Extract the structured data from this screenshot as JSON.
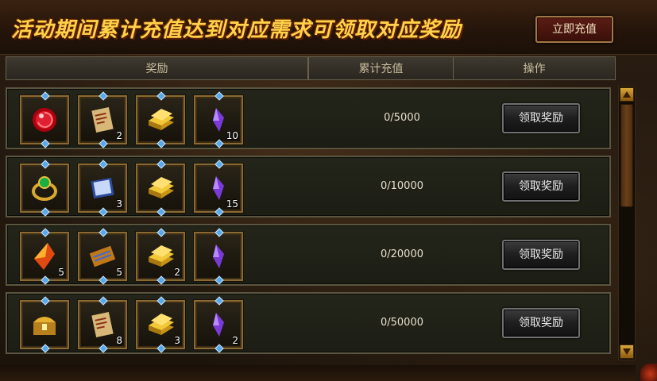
{
  "header": {
    "title": "活动期间累计充值达到对应需求可领取对应奖励",
    "topup_button": "立即充值"
  },
  "columns": {
    "reward": "奖励",
    "total_recharge": "累计充值",
    "action": "操作"
  },
  "rows": [
    {
      "progress": "0/5000",
      "button": "领取奖励",
      "items": [
        {
          "icon": "red-orb-icon",
          "count": ""
        },
        {
          "icon": "scroll-icon",
          "count": "2"
        },
        {
          "icon": "gold-bar-icon",
          "count": ""
        },
        {
          "icon": "purple-crystal-icon",
          "count": "10"
        }
      ]
    },
    {
      "progress": "0/10000",
      "button": "领取奖励",
      "items": [
        {
          "icon": "emerald-ring-icon",
          "count": ""
        },
        {
          "icon": "blue-book-icon",
          "count": "3"
        },
        {
          "icon": "gold-bar-icon",
          "count": ""
        },
        {
          "icon": "purple-crystal-icon",
          "count": "15"
        }
      ]
    },
    {
      "progress": "0/20000",
      "button": "领取奖励",
      "items": [
        {
          "icon": "fire-gem-icon",
          "count": "5"
        },
        {
          "icon": "skill-book-icon",
          "count": "5"
        },
        {
          "icon": "gold-bar-icon",
          "count": "2"
        },
        {
          "icon": "purple-crystal-icon",
          "count": ""
        }
      ]
    },
    {
      "progress": "0/50000",
      "button": "领取奖励",
      "items": [
        {
          "icon": "treasure-chest-icon",
          "count": ""
        },
        {
          "icon": "scroll-icon",
          "count": "8"
        },
        {
          "icon": "gold-bar-icon",
          "count": "3"
        },
        {
          "icon": "purple-crystal-icon",
          "count": "2"
        }
      ]
    }
  ],
  "colors": {
    "title": "#ffd24a",
    "slot_border": "#8a6a32",
    "row_border": "#5a5540"
  }
}
